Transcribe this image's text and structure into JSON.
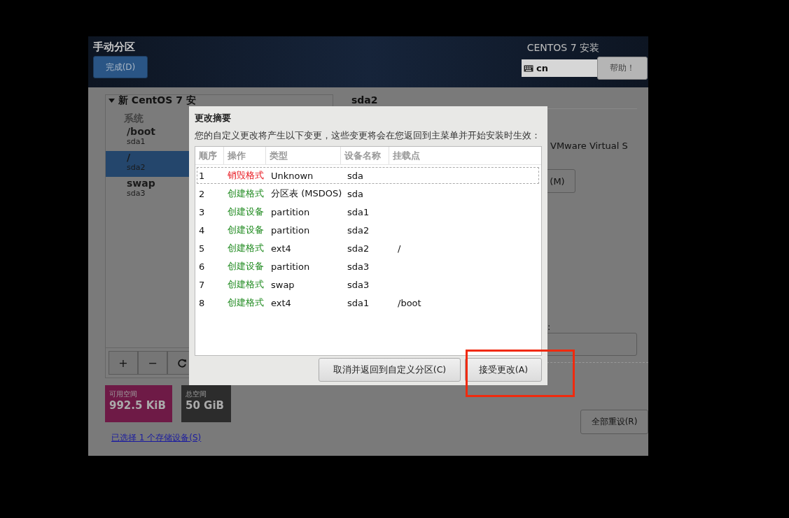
{
  "window": {
    "title": "手动分区",
    "done_button": "完成(D)",
    "product": "CENTOS 7 安装",
    "keyboard": "cn",
    "help_button": "帮助！"
  },
  "partitions": {
    "title": "新 CentOS 7 安",
    "expanded": true,
    "groups": [
      {
        "label": "系统",
        "items": [
          {
            "mount": "/boot",
            "device": "sda1",
            "selected": false
          },
          {
            "mount": "/",
            "device": "sda2",
            "selected": true
          },
          {
            "mount": "swap",
            "device": "sda3",
            "selected": false
          }
        ]
      }
    ]
  },
  "toolbar": [
    "+",
    "−"
  ],
  "space": [
    {
      "label": "可用空间",
      "value": "992.5 KiB",
      "kind": "free"
    },
    {
      "label": "总空间",
      "value": "50 GiB",
      "kind": "total"
    }
  ],
  "storage_link": "已选择 1 个存储设备(S)",
  "detail": {
    "title": "sda2",
    "device_text": "VMware Virtual S",
    "modify_button": "(M)",
    "field_label": ":"
  },
  "reset_button": "全部重设(R)",
  "dialog": {
    "title": "更改摘要",
    "message": "您的自定义更改将产生以下变更，这些变更将会在您返回到主菜单并开始安装时生效：",
    "columns": [
      "顺序",
      "操作",
      "类型",
      "设备名称",
      "挂载点"
    ],
    "rows": [
      {
        "order": "1",
        "action": "销毁格式",
        "color": "#e8141c",
        "type": "Unknown",
        "device": "sda",
        "focused": true
      },
      {
        "order": "2",
        "action": "创建格式",
        "color": "#1f8a1f",
        "type": "分区表 (MSDOS)",
        "device": "sda",
        "focused": false
      },
      {
        "order": "3",
        "action": "创建设备",
        "color": "#1f8a1f",
        "type": "partition",
        "device": "sda1",
        "focused": false
      },
      {
        "order": "4",
        "action": "创建设备",
        "color": "#1f8a1f",
        "type": "partition",
        "device": "sda2",
        "focused": false
      },
      {
        "order": "5",
        "action": "创建格式",
        "color": "#1f8a1f",
        "type": "ext4",
        "device": "sda2",
        "mount": "/",
        "focused": false
      },
      {
        "order": "6",
        "action": "创建设备",
        "color": "#1f8a1f",
        "type": "partition",
        "device": "sda3",
        "focused": false
      },
      {
        "order": "7",
        "action": "创建格式",
        "color": "#1f8a1f",
        "type": "swap",
        "device": "sda3",
        "focused": false
      },
      {
        "order": "8",
        "action": "创建格式",
        "color": "#1f8a1f",
        "type": "ext4",
        "device": "sda1",
        "mount": "/boot",
        "focused": false
      }
    ],
    "buttons": [
      "取消并返回到自定义分区(C)",
      "接受更改(A)"
    ]
  }
}
